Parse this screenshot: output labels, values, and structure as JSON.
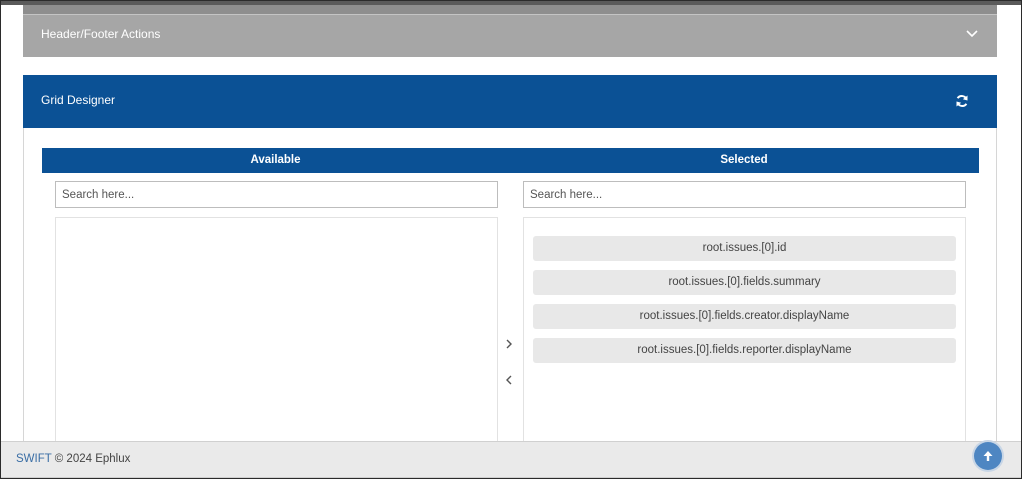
{
  "header_footer_panel": {
    "title": "Header/Footer Actions",
    "icon": "chevron-down-icon"
  },
  "grid_designer": {
    "title": "Grid Designer",
    "refresh_icon": "refresh-icon",
    "available": {
      "label": "Available",
      "search_placeholder": "Search here...",
      "items": []
    },
    "selected": {
      "label": "Selected",
      "search_placeholder": "Search here...",
      "items": [
        {
          "label": "root.issues.[0].id"
        },
        {
          "label": "root.issues.[0].fields.summary"
        },
        {
          "label": "root.issues.[0].fields.creator.displayName"
        },
        {
          "label": "root.issues.[0].fields.reporter.displayName"
        }
      ]
    },
    "move_right_icon": "chevron-right-icon",
    "move_left_icon": "chevron-left-icon"
  },
  "footer": {
    "brand": "SWIFT",
    "copyright": "© 2024 Ephlux",
    "scroll_top_icon": "arrow-up-icon"
  },
  "colors": {
    "primary": "#0b5195",
    "collapsed_panel": "#a6a6a6",
    "footer_bg": "#eaeaea",
    "item_bg": "#e8e8e8",
    "scroll_top_button": "#4e86c2"
  }
}
